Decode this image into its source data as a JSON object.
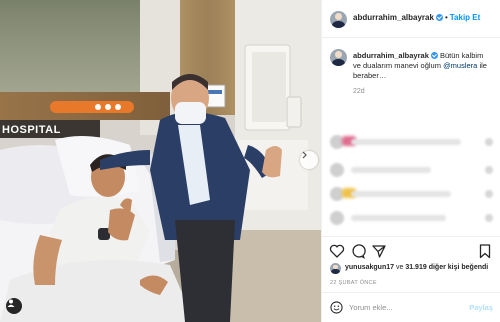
{
  "photo": {
    "hospital_sign": "HOSPITAL",
    "accent_color": "#e8782a"
  },
  "header": {
    "username": "abdurrahim_albayrak",
    "separator": "•",
    "follow_label": "Takip Et"
  },
  "caption": {
    "username": "abdurrahim_albayrak",
    "text_before": "Bütün kalbim ve dualarım manevi oğlum",
    "mention": "@muslera",
    "text_after": "ile beraber…",
    "age": "22d"
  },
  "likes": {
    "user": "yunusakgun17",
    "connector": "ve",
    "count": "31.919",
    "suffix": "diğer kişi beğendi"
  },
  "date": "22 ŞUBAT ÖNCE",
  "comment": {
    "placeholder": "Yorum ekle...",
    "post_label": "Paylaş"
  },
  "icons": {
    "like": "heart-icon",
    "comment": "comment-icon",
    "share": "share-icon",
    "save": "bookmark-icon",
    "emoji": "smiley-icon",
    "next": "chevron-right-icon",
    "tags": "user-tag-icon"
  }
}
